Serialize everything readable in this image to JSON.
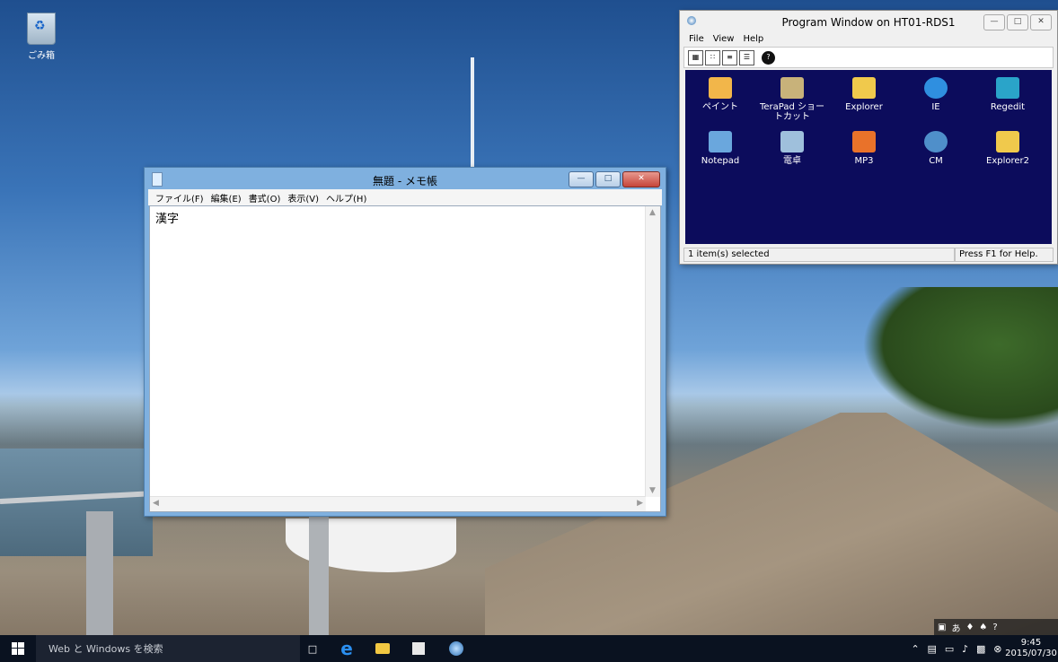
{
  "desktop": {
    "recycle_bin_label": "ごみ箱"
  },
  "notepad": {
    "title": "無題 - メモ帳",
    "menu": [
      "ファイル(F)",
      "編集(E)",
      "書式(O)",
      "表示(V)",
      "ヘルプ(H)"
    ],
    "content": "漢字"
  },
  "program_window": {
    "title": "Program Window on HT01-RDS1",
    "menu": [
      "File",
      "View",
      "Help"
    ],
    "items": [
      {
        "label": "ペイント",
        "icon": "paint-icon",
        "color": "#f2b64a"
      },
      {
        "label": "TeraPad ショートカット",
        "icon": "terapad-icon",
        "color": "#c8b27a"
      },
      {
        "label": "Explorer",
        "icon": "folder-icon",
        "color": "#f0c94c"
      },
      {
        "label": "IE",
        "icon": "ie-icon",
        "color": "#2f8fe0"
      },
      {
        "label": "Regedit",
        "icon": "regedit-icon",
        "color": "#2aa4c9"
      },
      {
        "label": "Notepad",
        "icon": "notepad-icon",
        "color": "#6aa7dd"
      },
      {
        "label": "電卓",
        "icon": "calculator-icon",
        "color": "#9fc0dc"
      },
      {
        "label": "MP3",
        "icon": "media-icon",
        "color": "#e9722a"
      },
      {
        "label": "CM",
        "icon": "globe-icon",
        "color": "#4f8fca"
      },
      {
        "label": "Explorer2",
        "icon": "folder-icon",
        "color": "#f0c94c"
      }
    ],
    "status_left": "1 item(s) selected",
    "status_right": "Press F1 for Help."
  },
  "taskbar": {
    "search_placeholder": "Web と Windows を検索",
    "time": "9:45",
    "date": "2015/07/30"
  }
}
